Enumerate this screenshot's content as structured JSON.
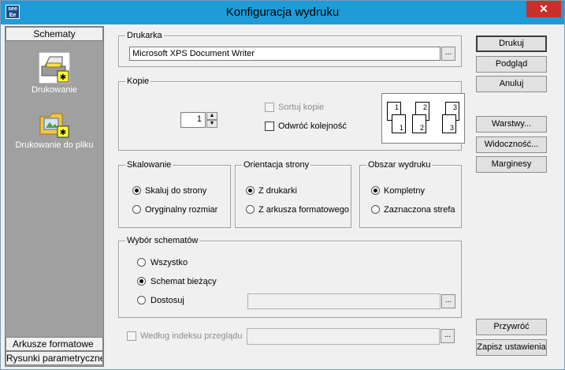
{
  "window": {
    "title": "Konfiguracja wydruku",
    "app_icon_text": "see Ee",
    "close_glyph": "✕"
  },
  "left_pane": {
    "top_tab": "Schematy",
    "items": [
      {
        "label": "Drukowanie",
        "icon": "printer-icon"
      },
      {
        "label": "Drukowanie do pliku",
        "icon": "folder-icon"
      }
    ],
    "bottom_tabs": [
      "Arkusze formatowe",
      "Rysunki parametryczne"
    ]
  },
  "printer": {
    "title": "Drukarka",
    "value": "Microsoft XPS Document Writer",
    "browse": "..."
  },
  "copies": {
    "title": "Kopie",
    "count": "1",
    "sort_label": "Sortuj kopie",
    "reverse_label": "Odwróć kolejność",
    "preview_pages": [
      "1",
      "1",
      "2",
      "2",
      "3",
      "3"
    ]
  },
  "scaling": {
    "title": "Skalowanie",
    "options": [
      "Skaluj do strony",
      "Oryginalny rozmiar"
    ]
  },
  "orientation": {
    "title": "Orientacja strony",
    "options": [
      "Z drukarki",
      "Z arkusza formatowego"
    ]
  },
  "print_area": {
    "title": "Obszar wydruku",
    "options": [
      "Kompletny",
      "Zaznaczona strefa"
    ]
  },
  "scheme_selection": {
    "title": "Wybór schematów",
    "options": [
      "Wszystko",
      "Schemat bieżący",
      "Dostosuj"
    ],
    "customize_value": "",
    "browse": "...",
    "by_index_label": "Według indeksu przeglądu",
    "by_index_value": "",
    "by_index_browse": "..."
  },
  "buttons": {
    "print": "Drukuj",
    "preview": "Podgląd",
    "cancel": "Anuluj",
    "layers": "Warstwy...",
    "visibility": "Widoczność...",
    "margins": "Marginesy",
    "restore": "Przywróć",
    "save_settings": "Zapisz ustawienia"
  }
}
